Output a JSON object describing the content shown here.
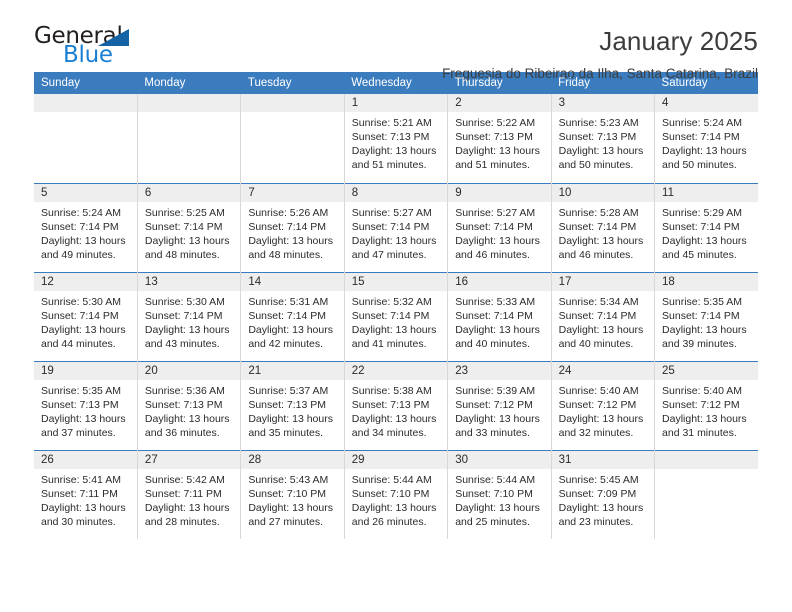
{
  "logo": {
    "text_primary": "General",
    "text_secondary": "Blue",
    "accent_color": "#1464a5",
    "blue_color": "#1b7fd4"
  },
  "header": {
    "title": "January 2025",
    "subtitle": "Freguesia do Ribeirao da Ilha, Santa Catarina, Brazil"
  },
  "theme": {
    "header_row_bg": "#3b7cbf",
    "daynum_bg": "#eeeeee",
    "text_color": "#2b2b2b"
  },
  "weekday_headers": [
    "Sunday",
    "Monday",
    "Tuesday",
    "Wednesday",
    "Thursday",
    "Friday",
    "Saturday"
  ],
  "weeks": [
    [
      {
        "day": "",
        "empty": true
      },
      {
        "day": "",
        "empty": true
      },
      {
        "day": "",
        "empty": true
      },
      {
        "day": "1",
        "sunrise": "Sunrise: 5:21 AM",
        "sunset": "Sunset: 7:13 PM",
        "daylight_line1": "Daylight: 13 hours",
        "daylight_line2": "and 51 minutes."
      },
      {
        "day": "2",
        "sunrise": "Sunrise: 5:22 AM",
        "sunset": "Sunset: 7:13 PM",
        "daylight_line1": "Daylight: 13 hours",
        "daylight_line2": "and 51 minutes."
      },
      {
        "day": "3",
        "sunrise": "Sunrise: 5:23 AM",
        "sunset": "Sunset: 7:13 PM",
        "daylight_line1": "Daylight: 13 hours",
        "daylight_line2": "and 50 minutes."
      },
      {
        "day": "4",
        "sunrise": "Sunrise: 5:24 AM",
        "sunset": "Sunset: 7:14 PM",
        "daylight_line1": "Daylight: 13 hours",
        "daylight_line2": "and 50 minutes."
      }
    ],
    [
      {
        "day": "5",
        "sunrise": "Sunrise: 5:24 AM",
        "sunset": "Sunset: 7:14 PM",
        "daylight_line1": "Daylight: 13 hours",
        "daylight_line2": "and 49 minutes."
      },
      {
        "day": "6",
        "sunrise": "Sunrise: 5:25 AM",
        "sunset": "Sunset: 7:14 PM",
        "daylight_line1": "Daylight: 13 hours",
        "daylight_line2": "and 48 minutes."
      },
      {
        "day": "7",
        "sunrise": "Sunrise: 5:26 AM",
        "sunset": "Sunset: 7:14 PM",
        "daylight_line1": "Daylight: 13 hours",
        "daylight_line2": "and 48 minutes."
      },
      {
        "day": "8",
        "sunrise": "Sunrise: 5:27 AM",
        "sunset": "Sunset: 7:14 PM",
        "daylight_line1": "Daylight: 13 hours",
        "daylight_line2": "and 47 minutes."
      },
      {
        "day": "9",
        "sunrise": "Sunrise: 5:27 AM",
        "sunset": "Sunset: 7:14 PM",
        "daylight_line1": "Daylight: 13 hours",
        "daylight_line2": "and 46 minutes."
      },
      {
        "day": "10",
        "sunrise": "Sunrise: 5:28 AM",
        "sunset": "Sunset: 7:14 PM",
        "daylight_line1": "Daylight: 13 hours",
        "daylight_line2": "and 46 minutes."
      },
      {
        "day": "11",
        "sunrise": "Sunrise: 5:29 AM",
        "sunset": "Sunset: 7:14 PM",
        "daylight_line1": "Daylight: 13 hours",
        "daylight_line2": "and 45 minutes."
      }
    ],
    [
      {
        "day": "12",
        "sunrise": "Sunrise: 5:30 AM",
        "sunset": "Sunset: 7:14 PM",
        "daylight_line1": "Daylight: 13 hours",
        "daylight_line2": "and 44 minutes."
      },
      {
        "day": "13",
        "sunrise": "Sunrise: 5:30 AM",
        "sunset": "Sunset: 7:14 PM",
        "daylight_line1": "Daylight: 13 hours",
        "daylight_line2": "and 43 minutes."
      },
      {
        "day": "14",
        "sunrise": "Sunrise: 5:31 AM",
        "sunset": "Sunset: 7:14 PM",
        "daylight_line1": "Daylight: 13 hours",
        "daylight_line2": "and 42 minutes."
      },
      {
        "day": "15",
        "sunrise": "Sunrise: 5:32 AM",
        "sunset": "Sunset: 7:14 PM",
        "daylight_line1": "Daylight: 13 hours",
        "daylight_line2": "and 41 minutes."
      },
      {
        "day": "16",
        "sunrise": "Sunrise: 5:33 AM",
        "sunset": "Sunset: 7:14 PM",
        "daylight_line1": "Daylight: 13 hours",
        "daylight_line2": "and 40 minutes."
      },
      {
        "day": "17",
        "sunrise": "Sunrise: 5:34 AM",
        "sunset": "Sunset: 7:14 PM",
        "daylight_line1": "Daylight: 13 hours",
        "daylight_line2": "and 40 minutes."
      },
      {
        "day": "18",
        "sunrise": "Sunrise: 5:35 AM",
        "sunset": "Sunset: 7:14 PM",
        "daylight_line1": "Daylight: 13 hours",
        "daylight_line2": "and 39 minutes."
      }
    ],
    [
      {
        "day": "19",
        "sunrise": "Sunrise: 5:35 AM",
        "sunset": "Sunset: 7:13 PM",
        "daylight_line1": "Daylight: 13 hours",
        "daylight_line2": "and 37 minutes."
      },
      {
        "day": "20",
        "sunrise": "Sunrise: 5:36 AM",
        "sunset": "Sunset: 7:13 PM",
        "daylight_line1": "Daylight: 13 hours",
        "daylight_line2": "and 36 minutes."
      },
      {
        "day": "21",
        "sunrise": "Sunrise: 5:37 AM",
        "sunset": "Sunset: 7:13 PM",
        "daylight_line1": "Daylight: 13 hours",
        "daylight_line2": "and 35 minutes."
      },
      {
        "day": "22",
        "sunrise": "Sunrise: 5:38 AM",
        "sunset": "Sunset: 7:13 PM",
        "daylight_line1": "Daylight: 13 hours",
        "daylight_line2": "and 34 minutes."
      },
      {
        "day": "23",
        "sunrise": "Sunrise: 5:39 AM",
        "sunset": "Sunset: 7:12 PM",
        "daylight_line1": "Daylight: 13 hours",
        "daylight_line2": "and 33 minutes."
      },
      {
        "day": "24",
        "sunrise": "Sunrise: 5:40 AM",
        "sunset": "Sunset: 7:12 PM",
        "daylight_line1": "Daylight: 13 hours",
        "daylight_line2": "and 32 minutes."
      },
      {
        "day": "25",
        "sunrise": "Sunrise: 5:40 AM",
        "sunset": "Sunset: 7:12 PM",
        "daylight_line1": "Daylight: 13 hours",
        "daylight_line2": "and 31 minutes."
      }
    ],
    [
      {
        "day": "26",
        "sunrise": "Sunrise: 5:41 AM",
        "sunset": "Sunset: 7:11 PM",
        "daylight_line1": "Daylight: 13 hours",
        "daylight_line2": "and 30 minutes."
      },
      {
        "day": "27",
        "sunrise": "Sunrise: 5:42 AM",
        "sunset": "Sunset: 7:11 PM",
        "daylight_line1": "Daylight: 13 hours",
        "daylight_line2": "and 28 minutes."
      },
      {
        "day": "28",
        "sunrise": "Sunrise: 5:43 AM",
        "sunset": "Sunset: 7:10 PM",
        "daylight_line1": "Daylight: 13 hours",
        "daylight_line2": "and 27 minutes."
      },
      {
        "day": "29",
        "sunrise": "Sunrise: 5:44 AM",
        "sunset": "Sunset: 7:10 PM",
        "daylight_line1": "Daylight: 13 hours",
        "daylight_line2": "and 26 minutes."
      },
      {
        "day": "30",
        "sunrise": "Sunrise: 5:44 AM",
        "sunset": "Sunset: 7:10 PM",
        "daylight_line1": "Daylight: 13 hours",
        "daylight_line2": "and 25 minutes."
      },
      {
        "day": "31",
        "sunrise": "Sunrise: 5:45 AM",
        "sunset": "Sunset: 7:09 PM",
        "daylight_line1": "Daylight: 13 hours",
        "daylight_line2": "and 23 minutes."
      },
      {
        "day": "",
        "empty": true
      }
    ]
  ]
}
